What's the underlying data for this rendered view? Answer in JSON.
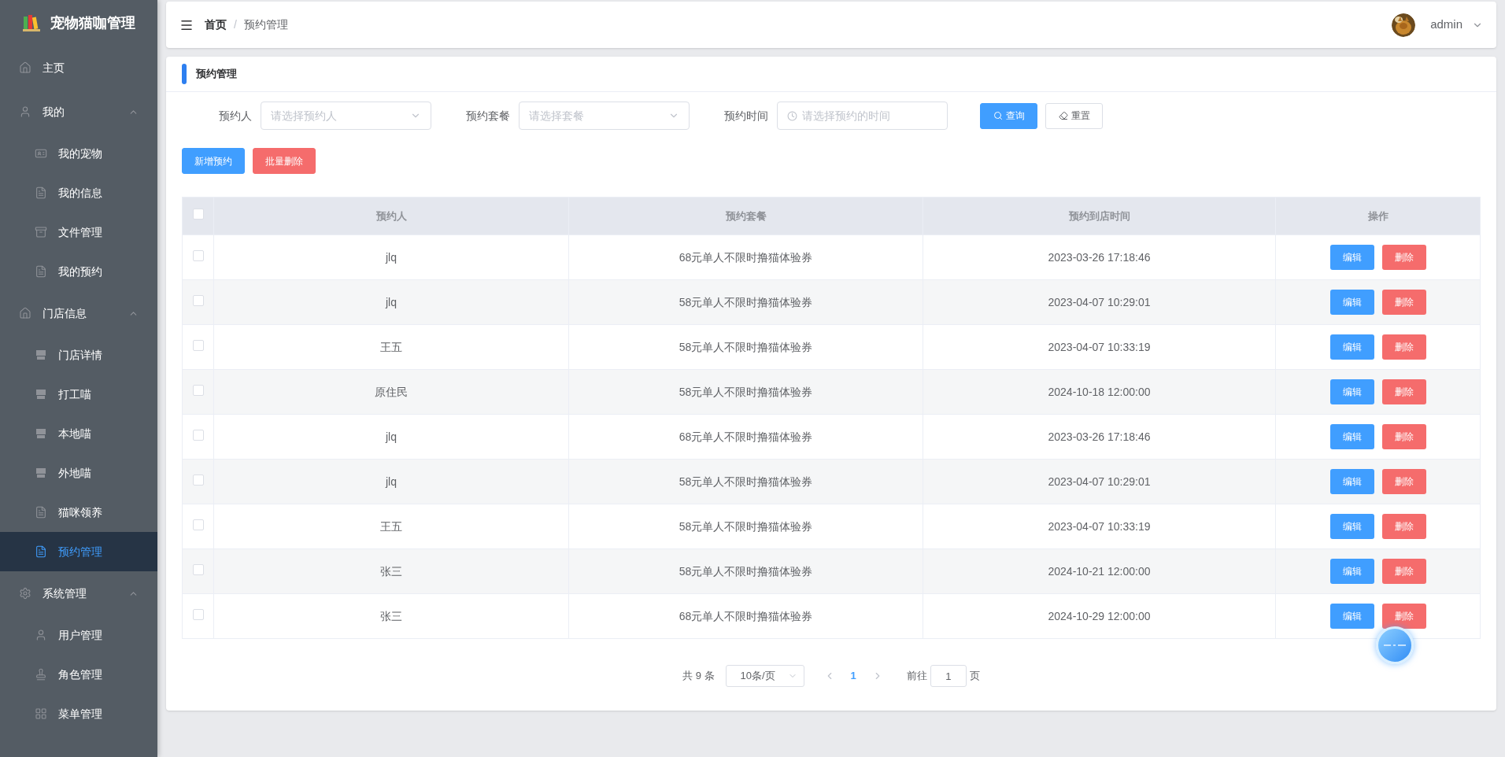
{
  "sidebar": {
    "logo_text": "宠物猫咖管理",
    "items": [
      {
        "label": "主页",
        "selected": false
      },
      {
        "label": "我的",
        "expanded": true,
        "children": [
          {
            "label": "我的宠物",
            "selected": false
          },
          {
            "label": "我的信息",
            "selected": false
          },
          {
            "label": "文件管理",
            "selected": false
          },
          {
            "label": "我的预约",
            "selected": false
          }
        ]
      },
      {
        "label": "门店信息",
        "expanded": true,
        "children": [
          {
            "label": "门店详情",
            "selected": false
          },
          {
            "label": "打工喵",
            "selected": false
          },
          {
            "label": "本地喵",
            "selected": false
          },
          {
            "label": "外地喵",
            "selected": false
          },
          {
            "label": "猫咪领养",
            "selected": false
          },
          {
            "label": "预约管理",
            "selected": true
          }
        ]
      },
      {
        "label": "系统管理",
        "expanded": true,
        "children": [
          {
            "label": "用户管理",
            "selected": false
          },
          {
            "label": "角色管理",
            "selected": false
          },
          {
            "label": "菜单管理",
            "selected": false
          }
        ]
      }
    ]
  },
  "header": {
    "breadcrumb": [
      "首页",
      "预约管理"
    ],
    "separator": "/",
    "user": "admin"
  },
  "card": {
    "title": "预约管理"
  },
  "filters": [
    {
      "kind": "select",
      "label": "预约人",
      "placeholder": "请选择预约人"
    },
    {
      "kind": "select",
      "label": "预约套餐",
      "placeholder": "请选择套餐"
    },
    {
      "kind": "date",
      "label": "预约时间",
      "placeholder": "请选择预约的时间"
    }
  ],
  "filter_buttons": [
    {
      "kind": "primary",
      "label": "查询"
    },
    {
      "kind": "plain",
      "label": "重置"
    }
  ],
  "actions": [
    {
      "kind": "primary",
      "label": "新增预约"
    },
    {
      "kind": "danger",
      "label": "批量删除"
    }
  ],
  "table": {
    "select_all": {
      "checked": false
    },
    "columns": [
      "预约人",
      "预约套餐",
      "预约到店时间",
      "操作"
    ],
    "rows": [
      {
        "checked": false,
        "name": "jlq",
        "package": "68元单人不限时撸猫体验券",
        "time": "2023-03-26 17:18:46",
        "actions": [
          "编辑",
          "删除"
        ]
      },
      {
        "checked": false,
        "name": "jlq",
        "package": "58元单人不限时撸猫体验券",
        "time": "2023-04-07 10:29:01",
        "actions": [
          "编辑",
          "删除"
        ]
      },
      {
        "checked": false,
        "name": "王五",
        "package": "58元单人不限时撸猫体验券",
        "time": "2023-04-07 10:33:19",
        "actions": [
          "编辑",
          "删除"
        ]
      },
      {
        "checked": false,
        "name": "原住民",
        "package": "58元单人不限时撸猫体验券",
        "time": "2024-10-18 12:00:00",
        "actions": [
          "编辑",
          "删除"
        ]
      },
      {
        "checked": false,
        "name": "jlq",
        "package": "68元单人不限时撸猫体验券",
        "time": "2023-03-26 17:18:46",
        "actions": [
          "编辑",
          "删除"
        ]
      },
      {
        "checked": false,
        "name": "jlq",
        "package": "58元单人不限时撸猫体验券",
        "time": "2023-04-07 10:29:01",
        "actions": [
          "编辑",
          "删除"
        ]
      },
      {
        "checked": false,
        "name": "王五",
        "package": "58元单人不限时撸猫体验券",
        "time": "2023-04-07 10:33:19",
        "actions": [
          "编辑",
          "删除"
        ]
      },
      {
        "checked": false,
        "name": "张三",
        "package": "58元单人不限时撸猫体验券",
        "time": "2024-10-21 12:00:00",
        "actions": [
          "编辑",
          "删除"
        ]
      },
      {
        "checked": false,
        "name": "张三",
        "package": "68元单人不限时撸猫体验券",
        "time": "2024-10-29 12:00:00",
        "actions": [
          "编辑",
          "删除"
        ]
      }
    ]
  },
  "pagination": {
    "total": "共 9 条",
    "page_size": "10条/页",
    "pages": [
      {
        "label": "1",
        "selected": true
      }
    ],
    "goto_label": "前往",
    "goto_value": "1",
    "goto_suffix": "页"
  }
}
